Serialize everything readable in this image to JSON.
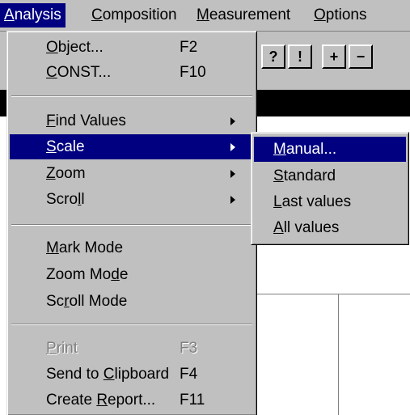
{
  "menubar": {
    "items": [
      {
        "label": "Analysis",
        "mnemonic": "A",
        "rest": "nalysis"
      },
      {
        "label": "Composition",
        "mnemonic": "C",
        "rest": "omposition"
      },
      {
        "label": "Measurement",
        "mnemonic": "M",
        "rest": "easurement"
      },
      {
        "label": "Options",
        "mnemonic": "O",
        "rest": "ptions"
      }
    ]
  },
  "toolbar": {
    "buttons": [
      {
        "icon": "help-query-icon",
        "glyph": "?"
      },
      {
        "icon": "exclamation-icon",
        "glyph": "!"
      },
      {
        "icon": "zoom-in-icon",
        "glyph": "+"
      },
      {
        "icon": "zoom-out-icon",
        "glyph": "−"
      }
    ]
  },
  "analysis_menu": {
    "items": [
      {
        "pre": "",
        "u": "O",
        "post": "bject...",
        "shortcut": "F2"
      },
      {
        "pre": "",
        "u": "C",
        "post": "ONST...",
        "shortcut": "F10"
      },
      {
        "pre": "",
        "u": "F",
        "post": "ind Values",
        "submenu": true
      },
      {
        "pre": "",
        "u": "S",
        "post": "cale",
        "submenu": true
      },
      {
        "pre": "",
        "u": "Z",
        "post": "oom",
        "submenu": true
      },
      {
        "pre": "Scro",
        "u": "l",
        "post": "l",
        "submenu": true
      },
      {
        "pre": "",
        "u": "M",
        "post": "ark Mode"
      },
      {
        "pre": "Zoom Mo",
        "u": "d",
        "post": "e"
      },
      {
        "pre": "Sc",
        "u": "r",
        "post": "oll Mode"
      },
      {
        "pre": "",
        "u": "P",
        "post": "rint",
        "shortcut": "F3"
      },
      {
        "pre": "Send to ",
        "u": "C",
        "post": "lipboard",
        "shortcut": "F4"
      },
      {
        "pre": "Create ",
        "u": "R",
        "post": "eport...",
        "shortcut": "F11"
      }
    ]
  },
  "scale_menu": {
    "items": [
      {
        "pre": "",
        "u": "M",
        "post": "anual..."
      },
      {
        "pre": "",
        "u": "S",
        "post": "tandard"
      },
      {
        "pre": "",
        "u": "L",
        "post": "ast values"
      },
      {
        "pre": "",
        "u": "A",
        "post": "ll values"
      }
    ]
  },
  "colors": {
    "highlight": "#000080",
    "face": "#c0c0c0",
    "disabled": "#808080"
  }
}
